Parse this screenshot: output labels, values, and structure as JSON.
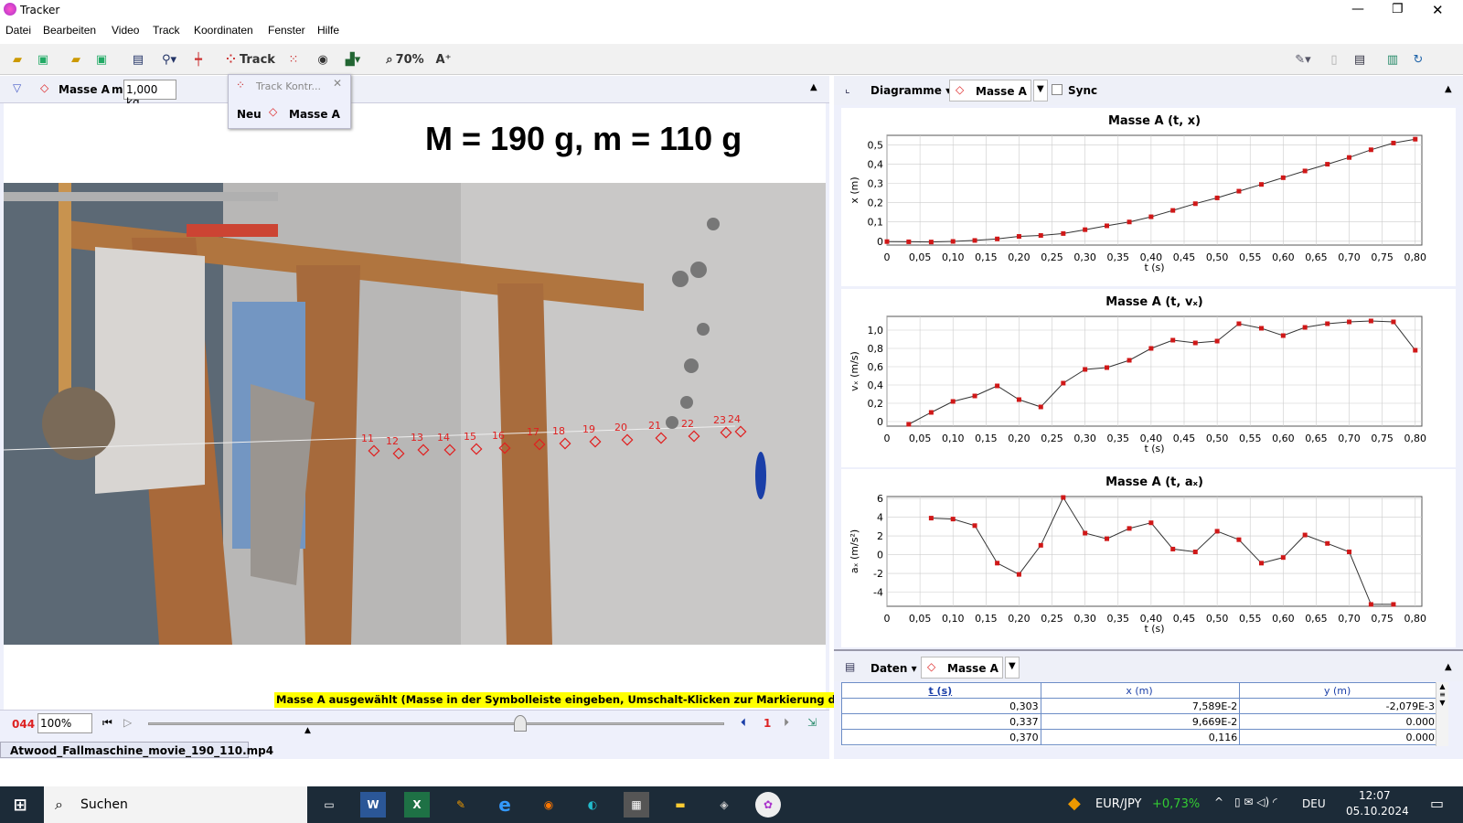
{
  "window": {
    "title": "Tracker",
    "min": "—",
    "max": "❐",
    "close": "✕"
  },
  "menu": [
    "Datei",
    "Bearbeiten",
    "Video",
    "Track",
    "Koordinaten",
    "Fenster",
    "Hilfe"
  ],
  "toolbar": {
    "track_label": "Track",
    "zoom": "70%",
    "font_btn": "A⁺"
  },
  "track_bar": {
    "mass_name": "Masse A",
    "m_label": "m",
    "m_value": "1,000 kg"
  },
  "popup": {
    "title": "Track Kontr...",
    "new_label": "Neu",
    "track": "Masse A"
  },
  "video": {
    "overlay": "M = 190 g, m = 110 g",
    "point_labels": [
      "11",
      "12",
      "13",
      "14",
      "15",
      "16",
      "17",
      "18",
      "19",
      "20",
      "21",
      "22",
      "23",
      "24"
    ]
  },
  "status_msg": "Masse A ausgewählt (Masse in der Symbolleiste eingeben, Umschalt-Klicken zur Markierung der Position)",
  "player": {
    "frame": "044",
    "speed": "100%",
    "step": "1"
  },
  "filename": "Atwood_Fallmaschine_movie_190_110.mp4",
  "plot_header": {
    "diagrams": "Diagramme",
    "track": "Masse A",
    "sync": "Sync"
  },
  "data_header": {
    "data": "Daten",
    "track": "Masse A"
  },
  "table": {
    "headers": [
      "t (s)",
      "x (m)",
      "y (m)"
    ],
    "rows": [
      [
        "0,303",
        "7,589E-2",
        "-2,079E-3"
      ],
      [
        "0,337",
        "9,669E-2",
        "0.000"
      ],
      [
        "0,370",
        "0,116",
        "0.000"
      ]
    ]
  },
  "taskbar": {
    "search": "Suchen",
    "currency": "EUR/JPY",
    "change": "+0,73%",
    "lang": "DEU",
    "time": "12:07",
    "date": "05.10.2024"
  },
  "chart_data": [
    {
      "type": "scatter",
      "title": "Masse A (t, x)",
      "xlabel": "t (s)",
      "ylabel": "x (m)",
      "xlim": [
        0,
        0.81
      ],
      "ylim": [
        -0.02,
        0.55
      ],
      "xticks": [
        "0",
        "0,05",
        "0,10",
        "0,15",
        "0,20",
        "0,25",
        "0,30",
        "0,35",
        "0,40",
        "0,45",
        "0,50",
        "0,55",
        "0,60",
        "0,65",
        "0,70",
        "0,75",
        "0,80"
      ],
      "yticks": [
        "0",
        "0,1",
        "0,2",
        "0,3",
        "0,4",
        "0,5"
      ],
      "x": [
        0,
        0.033,
        0.067,
        0.1,
        0.133,
        0.167,
        0.2,
        0.233,
        0.267,
        0.3,
        0.333,
        0.367,
        0.4,
        0.433,
        0.467,
        0.5,
        0.533,
        0.567,
        0.6,
        0.633,
        0.667,
        0.7,
        0.733,
        0.767,
        0.8
      ],
      "y": [
        -0.002,
        -0.003,
        -0.004,
        -0.001,
        0.004,
        0.012,
        0.025,
        0.03,
        0.04,
        0.06,
        0.08,
        0.1,
        0.127,
        0.16,
        0.195,
        0.225,
        0.26,
        0.295,
        0.33,
        0.365,
        0.4,
        0.435,
        0.475,
        0.51,
        0.53
      ]
    },
    {
      "type": "scatter",
      "title": "Masse A (t, vₓ)",
      "xlabel": "t (s)",
      "ylabel": "vₓ (m/s)",
      "xlim": [
        0,
        0.81
      ],
      "ylim": [
        -0.05,
        1.15
      ],
      "xticks": [
        "0",
        "0,05",
        "0,10",
        "0,15",
        "0,20",
        "0,25",
        "0,30",
        "0,35",
        "0,40",
        "0,45",
        "0,50",
        "0,55",
        "0,60",
        "0,65",
        "0,70",
        "0,75",
        "0,80"
      ],
      "yticks": [
        "0",
        "0,2",
        "0,4",
        "0,6",
        "0,8",
        "1,0"
      ],
      "x": [
        0.033,
        0.067,
        0.1,
        0.133,
        0.167,
        0.2,
        0.233,
        0.267,
        0.3,
        0.333,
        0.367,
        0.4,
        0.433,
        0.467,
        0.5,
        0.533,
        0.567,
        0.6,
        0.633,
        0.667,
        0.7,
        0.733,
        0.767,
        0.8
      ],
      "y": [
        -0.03,
        0.1,
        0.22,
        0.28,
        0.39,
        0.24,
        0.16,
        0.42,
        0.57,
        0.59,
        0.67,
        0.8,
        0.89,
        0.86,
        0.88,
        1.07,
        1.02,
        0.94,
        1.03,
        1.07,
        1.09,
        1.1,
        1.09,
        0.78
      ]
    },
    {
      "type": "scatter",
      "title": "Masse A (t, aₓ)",
      "xlabel": "t (s)",
      "ylabel": "aₓ (m/s²)",
      "xlim": [
        0,
        0.81
      ],
      "ylim": [
        -5.5,
        6.2
      ],
      "xticks": [
        "0",
        "0,05",
        "0,10",
        "0,15",
        "0,20",
        "0,25",
        "0,30",
        "0,35",
        "0,40",
        "0,45",
        "0,50",
        "0,55",
        "0,60",
        "0,65",
        "0,70",
        "0,75",
        "0,80"
      ],
      "yticks": [
        "6",
        "4",
        "2",
        "0",
        "-2",
        "-4"
      ],
      "x": [
        0.067,
        0.1,
        0.133,
        0.167,
        0.2,
        0.233,
        0.267,
        0.3,
        0.333,
        0.367,
        0.4,
        0.433,
        0.467,
        0.5,
        0.533,
        0.567,
        0.6,
        0.633,
        0.667,
        0.7,
        0.733,
        0.767
      ],
      "y": [
        3.9,
        3.8,
        3.1,
        -0.9,
        -2.1,
        1.0,
        6.1,
        2.3,
        1.7,
        2.8,
        3.4,
        0.6,
        0.3,
        2.5,
        1.6,
        -0.9,
        -0.3,
        2.1,
        1.2,
        0.3,
        -5.3,
        -5.3
      ]
    }
  ]
}
